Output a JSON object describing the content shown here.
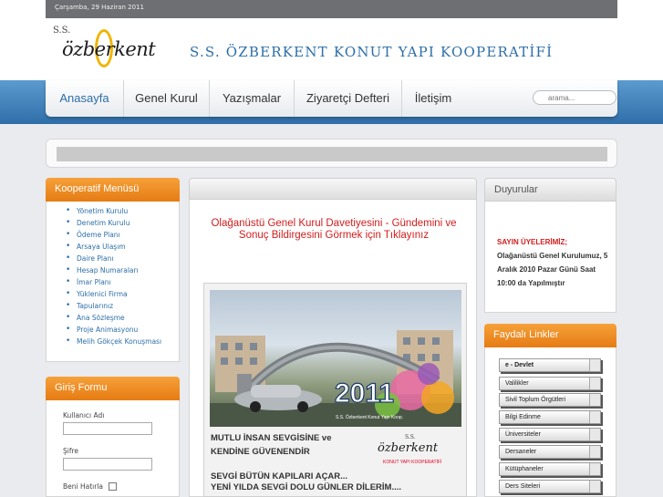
{
  "header": {
    "date": "Çarşamba, 29 Haziran 2011",
    "logo": {
      "ss": "S.S.",
      "word": "özberkent"
    },
    "site_title": "S.S. ÖZBERKENT KONUT YAPI KOOPERATİFİ"
  },
  "nav": {
    "items": [
      "Anasayfa",
      "Genel Kurul",
      "Yazışmalar",
      "Ziyaretçi Defteri",
      "İletişim"
    ],
    "search_placeholder": "arama..."
  },
  "menu": {
    "title": "Kooperatif Menüsü",
    "items": [
      "Yönetim Kurulu",
      "Denetim Kurulu",
      "Ödeme Planı",
      "Arsaya Ulaşım",
      "Daire Planı",
      "Hesap Numaraları",
      "İmar Planı",
      "Yüklenici Firma",
      "Tapularınız",
      "Ana Sözleşme",
      "Proje Animasyonu",
      "Melih Gökçek Konuşması"
    ]
  },
  "login": {
    "title": "Giriş Formu",
    "username_label": "Kullanıcı Adı",
    "password_label": "Şifre",
    "remember_label": "Beni Hatırla"
  },
  "main": {
    "notice": "Olağanüstü Genel Kurul Davetiyesini - Gündemini ve Sonuç Bildirgesini Görmek için Tıklayınız",
    "poster": {
      "year": "2011",
      "caption": "S.S. Özberkent Konut Yapı Koop.",
      "text1": "MUTLU İNSAN SEVGİSİNE ve KENDİNE GÜVENENDİR",
      "text2a": "SEVGİ BÜTÜN KAPILARI AÇAR...",
      "text2b": "YENİ YILDA SEVGİ DOLU GÜNLER DİLERİM....",
      "logo_ss": "S.S.",
      "logo_word": "özberkent",
      "logo_sub": "KONUT YAPI KOOPERATİFİ"
    }
  },
  "announcements": {
    "title": "Duyurular",
    "heading": "SAYIN ÜYELERİMİZ;",
    "body": "Olağanüstü Genel Kurulumuz, 5 Aralık 2010 Pazar Günü Saat 10:00 da Yapılmıştır"
  },
  "links": {
    "title": "Faydalı Linkler",
    "items": [
      "e - Devlet",
      "Valilikler",
      "Sivil Toplum Örgütleri",
      "Bilgi Edinme",
      "Üniversiteler",
      "Dersaneler",
      "Kütüphaneler",
      "Ders Siteleri"
    ]
  },
  "colors": {
    "accent_blue": "#2c6ea8",
    "orange_header": "#e67b13",
    "notice_red": "#d21d1d"
  }
}
